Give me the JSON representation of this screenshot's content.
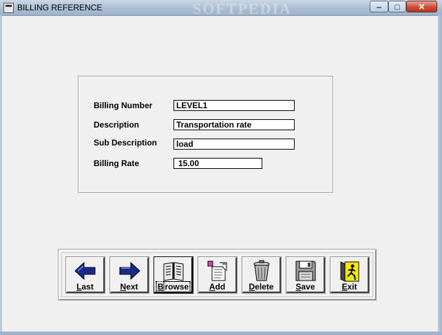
{
  "window": {
    "title": "BILLING REFERENCE",
    "watermark": "SOFTPEDIA",
    "controls": {
      "minimize": "‒",
      "maximize": "□",
      "close": "✕"
    }
  },
  "form": {
    "fields": [
      {
        "label": "Billing Number",
        "value": "LEVEL1"
      },
      {
        "label": "Description",
        "value": "Transportation rate"
      },
      {
        "label": "Sub Description",
        "value": "load"
      },
      {
        "label": "Billing Rate",
        "value": "15.00"
      }
    ]
  },
  "toolbar": {
    "buttons": [
      {
        "accel": "L",
        "rest": "ast",
        "icon": "left-arrow-icon"
      },
      {
        "accel": "N",
        "rest": "ext",
        "icon": "right-arrow-icon"
      },
      {
        "accel": "B",
        "rest": "rowse",
        "icon": "book-icon"
      },
      {
        "accel": "A",
        "rest": "dd",
        "icon": "add-document-icon"
      },
      {
        "accel": "D",
        "rest": "elete",
        "icon": "trash-can-icon"
      },
      {
        "accel": "S",
        "rest": "ave",
        "icon": "floppy-disk-icon"
      },
      {
        "accel": "E",
        "rest": "xit",
        "icon": "exit-door-icon"
      }
    ],
    "focused": "Browse"
  },
  "colors": {
    "titlebar": "#aabed3",
    "close_button": "#c9503a",
    "arrow_fill": "#1a2a8c"
  }
}
